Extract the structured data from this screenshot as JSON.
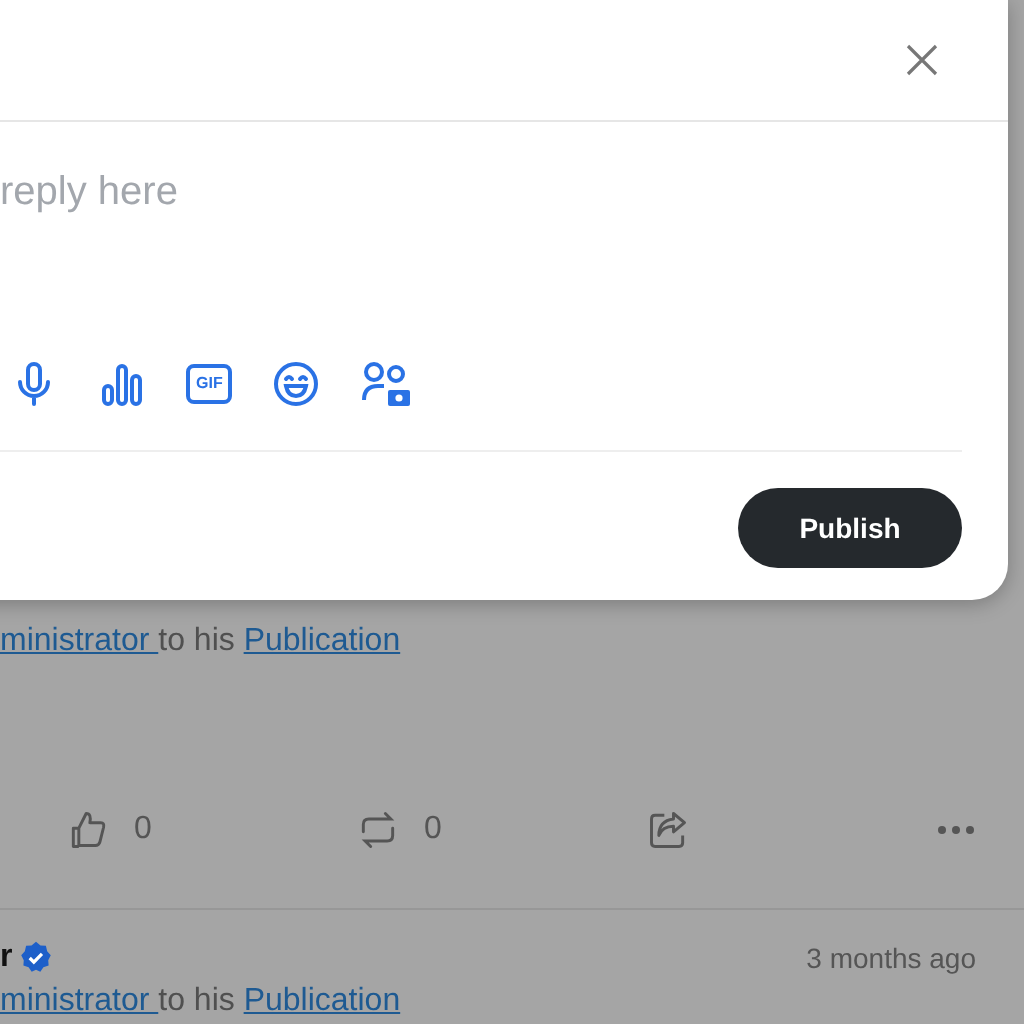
{
  "dialog": {
    "placeholder": "reply here",
    "tools": [
      {
        "kind": "mic"
      },
      {
        "kind": "poll"
      },
      {
        "kind": "gif",
        "label": "GIF"
      },
      {
        "kind": "emoji"
      },
      {
        "kind": "audience"
      }
    ],
    "publish": "Publish"
  },
  "posts": [
    {
      "segments": [
        {
          "text": "ministrator ",
          "link": true
        },
        {
          "text": "to his ",
          "link": false
        },
        {
          "text": "Publication",
          "link": true
        }
      ],
      "likes": "0",
      "reposts": "0"
    },
    {
      "name": "r",
      "verified": true,
      "time": "3 months ago",
      "segments": [
        {
          "text": "ministrator ",
          "link": true
        },
        {
          "text": "to his ",
          "link": false
        },
        {
          "text": "Publication",
          "link": true
        }
      ]
    }
  ]
}
